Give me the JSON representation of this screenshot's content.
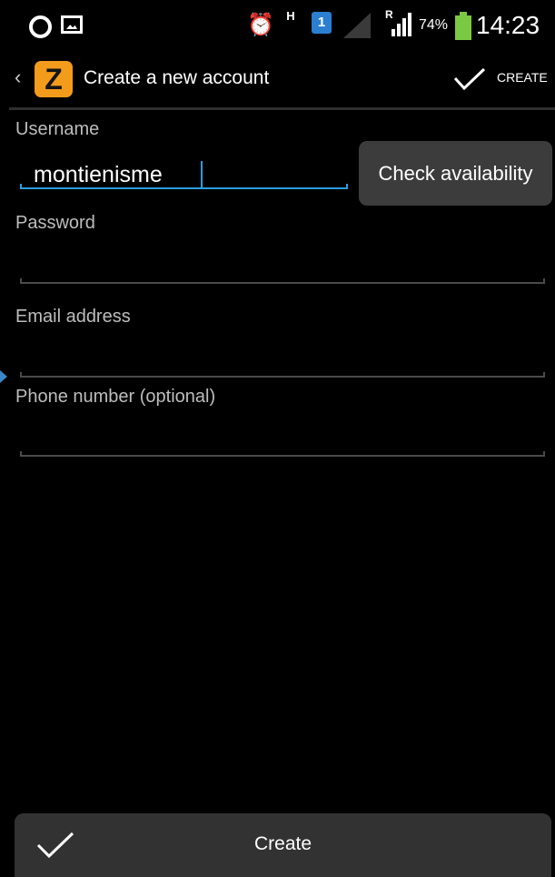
{
  "status_bar": {
    "alarm_icon": "alarm-clock-icon",
    "data_indicator": "H",
    "sim_badge": "1",
    "roaming_indicator": "R",
    "battery_percent": "74%",
    "time": "14:23",
    "battery_color": "#7ac943"
  },
  "action_bar": {
    "back_icon": "‹",
    "app_logo": "Zello",
    "title": "Create a new account",
    "create_label": "CREATE"
  },
  "form": {
    "username_label": "Username",
    "username_value": "montienisme",
    "check_availability_label": "Check availability",
    "password_label": "Password",
    "password_value": "",
    "email_label": "Email address",
    "email_value": "",
    "phone_label": "Phone number (optional)",
    "phone_value": ""
  },
  "bottom_bar": {
    "create_label": "Create"
  },
  "colors": {
    "accent": "#2a9de0",
    "logo": "#f39b1b",
    "button_bg": "#3c3c3c"
  }
}
